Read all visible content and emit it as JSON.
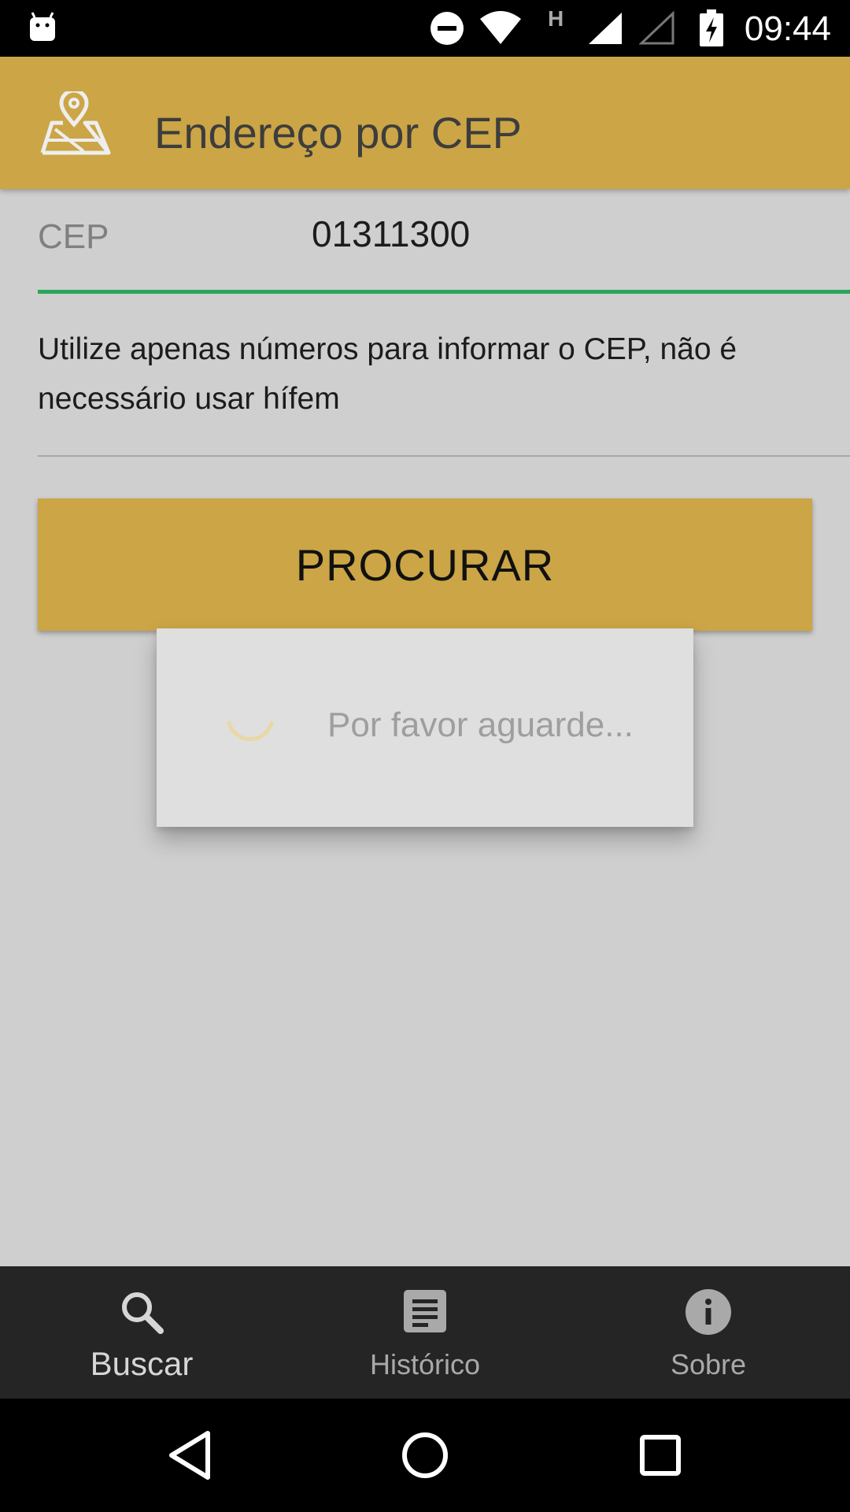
{
  "status_bar": {
    "time": "09:44",
    "network_type": "H",
    "icons": [
      "android-notification-icon",
      "do-not-disturb-icon",
      "wifi-icon",
      "signal-icon",
      "signal-empty-icon",
      "battery-charging-icon"
    ]
  },
  "app_bar": {
    "title": "Endereço por CEP",
    "icon": "map-pin-icon",
    "color": "#cba546"
  },
  "form": {
    "cep_label": "CEP",
    "cep_value": "01311300",
    "hint": "Utilize apenas números para informar o CEP, não é necessário usar hífem",
    "search_button": "PROCURAR",
    "accent_color": "#2aa55a"
  },
  "dialog": {
    "message": "Por favor aguarde..."
  },
  "bottom_nav": {
    "items": [
      {
        "label": "Buscar",
        "icon": "search-icon",
        "active": true
      },
      {
        "label": "Histórico",
        "icon": "history-icon",
        "active": false
      },
      {
        "label": "Sobre",
        "icon": "info-icon",
        "active": false
      }
    ]
  },
  "system_nav": [
    "back-icon",
    "home-icon",
    "recents-icon"
  ]
}
